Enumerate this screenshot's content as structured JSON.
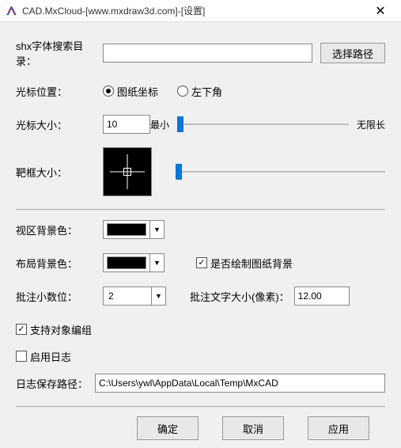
{
  "window": {
    "title": "CAD.MxCloud-[www.mxdraw3d.com]-[设置]"
  },
  "labels": {
    "shx_path": "shx字体搜索目录：",
    "browse": "选择路径",
    "cursor_pos": "光标位置：",
    "radio_paper": "图纸坐标",
    "radio_bottom_left": "左下角",
    "cursor_size": "光标大小：",
    "min": "最小",
    "unlimited": "无限长",
    "target_size": "靶框大小：",
    "viewport_bg": "视区背景色：",
    "layout_bg": "布局背景色：",
    "draw_paper_bg": "是否绘制图纸背景",
    "comment_precision": "批注小数位：",
    "comment_text_size": "批注文字大小(像素)：",
    "support_edit_group": "支持对象编组",
    "enable_log": "启用日志",
    "log_path": "日志保存路径：",
    "ok": "确定",
    "cancel": "取消",
    "apply": "应用"
  },
  "values": {
    "shx_path": "",
    "cursor_size": "10",
    "comment_precision": "2",
    "comment_text_size": "12.00",
    "log_path": "C:\\Users\\ywl\\AppData\\Local\\Temp\\MxCAD"
  },
  "state": {
    "cursor_pos_selected": "paper",
    "draw_paper_bg_checked": true,
    "support_edit_group_checked": true,
    "enable_log_checked": false,
    "viewport_bg_color": "#000000",
    "layout_bg_color": "#000000"
  }
}
